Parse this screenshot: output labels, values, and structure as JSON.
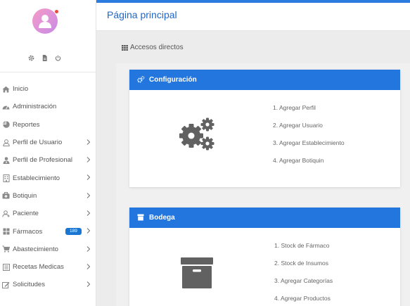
{
  "sidebar": {
    "user_tools": [
      "gear-icon",
      "file-icon",
      "power-icon"
    ],
    "items": [
      {
        "label": "Inicio",
        "icon": "home-icon",
        "chevron": false
      },
      {
        "label": "Administración",
        "icon": "dashboard-icon",
        "chevron": false
      },
      {
        "label": "Reportes",
        "icon": "pie-chart-icon",
        "chevron": false
      },
      {
        "label": "Perfil de Usuario",
        "icon": "user-icon",
        "chevron": true
      },
      {
        "label": "Perfil de Profesional",
        "icon": "user-doctor-icon",
        "chevron": true
      },
      {
        "label": "Establecimiento",
        "icon": "building-icon",
        "chevron": true
      },
      {
        "label": "Botiquin",
        "icon": "medkit-icon",
        "chevron": true
      },
      {
        "label": "Paciente",
        "icon": "patient-icon",
        "chevron": true
      },
      {
        "label": "Fármacos",
        "icon": "pills-icon",
        "chevron": true,
        "badge": "189"
      },
      {
        "label": "Abastecimiento",
        "icon": "cart-icon",
        "chevron": true
      },
      {
        "label": "Recetas Medicas",
        "icon": "list-icon",
        "chevron": true
      },
      {
        "label": "Solicitudes",
        "icon": "edit-icon",
        "chevron": true
      }
    ]
  },
  "header": {
    "title": "Página principal"
  },
  "main": {
    "section_label": "Accesos directos",
    "cards": [
      {
        "title": "Configuración",
        "icon": "cogs-icon",
        "links": [
          "1. Agregar Perfil",
          "2. Agregar Usuario",
          "3. Agregar Establecimiento",
          "4. Agregar Botiquin"
        ]
      },
      {
        "title": "Bodega",
        "icon": "archive-icon",
        "links": [
          "1. Stock de Fármaco",
          "2. Stock de Insumos",
          "3. Agregar Categorías",
          "4. Agregar Productos"
        ]
      }
    ]
  },
  "colors": {
    "accent": "#2276de",
    "title": "#1f66c9",
    "badge": "#1976d2",
    "avatar_dot": "#e84a3c"
  }
}
